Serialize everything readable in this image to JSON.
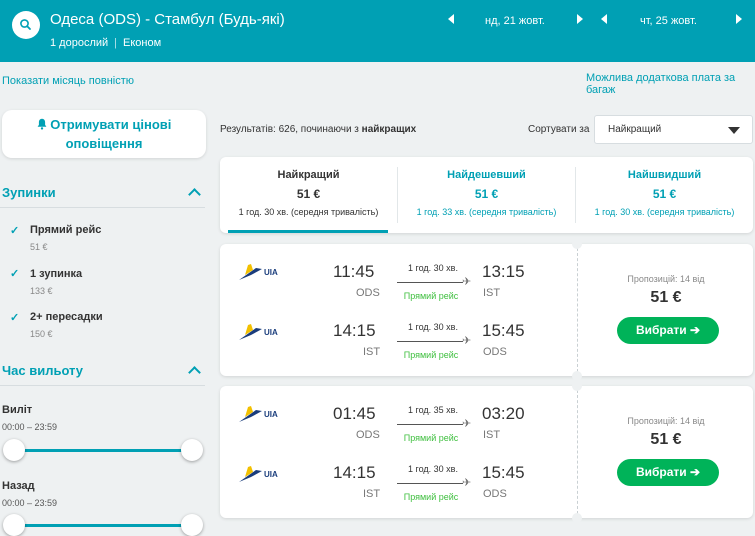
{
  "search": {
    "route": "Одеса (ODS) - Стамбул (Будь-які)",
    "passengers": "1 дорослий",
    "cabin": "Економ",
    "depart_date": "нд, 21 жовт.",
    "return_date": "чт, 25 жовт."
  },
  "links": {
    "show_month": "Показати місяць повністю",
    "baggage_fee": "Можлива додаткова плата за багаж"
  },
  "sidebar": {
    "alert_button_line1": "Отримувати цінові",
    "alert_button_line2": "оповіщення",
    "stops_title": "Зупинки",
    "stops": [
      {
        "label": "Прямий рейс",
        "price": "51 €"
      },
      {
        "label": "1 зупинка",
        "price": "133 €"
      },
      {
        "label": "2+ пересадки",
        "price": "150 €"
      }
    ],
    "depart_time_title": "Час вильоту",
    "outbound_label": "Виліт",
    "outbound_range": "00:00 – 23:59",
    "return_label": "Назад",
    "return_range": "00:00 – 23:59"
  },
  "results": {
    "prefix": "Результатів: 626, починаючи з ",
    "sort_word": "найкращих",
    "sort_label": "Сортувати за",
    "sort_value": "Найкращий"
  },
  "tabs": [
    {
      "title": "Найкращий",
      "price": "51 €",
      "duration": "1 год. 30 хв. (середня тривалість)"
    },
    {
      "title": "Найдешевший",
      "price": "51 €",
      "duration": "1 год. 33 хв. (середня тривалість)"
    },
    {
      "title": "Найшвидший",
      "price": "51 €",
      "duration": "1 год. 30 хв. (середня тривалість)"
    }
  ],
  "colors": {
    "accent": "#00a0b4",
    "button": "#00b359",
    "direct": "#3fbf3f"
  },
  "flights": [
    {
      "legs": [
        {
          "airline": "UIA",
          "dep_time": "11:45",
          "dep_code": "ODS",
          "duration": "1 год. 30 хв.",
          "stops": "Прямий рейс",
          "arr_time": "13:15",
          "arr_code": "IST"
        },
        {
          "airline": "UIA",
          "dep_time": "14:15",
          "dep_code": "IST",
          "duration": "1 год. 30 хв.",
          "stops": "Прямий рейс",
          "arr_time": "15:45",
          "arr_code": "ODS"
        }
      ],
      "offers": "Пропозицій: 14 від",
      "price": "51 €",
      "button": "Вибрати ➔"
    },
    {
      "legs": [
        {
          "airline": "UIA",
          "dep_time": "01:45",
          "dep_code": "ODS",
          "duration": "1 год. 35 хв.",
          "stops": "Прямий рейс",
          "arr_time": "03:20",
          "arr_code": "IST"
        },
        {
          "airline": "UIA",
          "dep_time": "14:15",
          "dep_code": "IST",
          "duration": "1 год. 30 хв.",
          "stops": "Прямий рейс",
          "arr_time": "15:45",
          "arr_code": "ODS"
        }
      ],
      "offers": "Пропозицій: 14 від",
      "price": "51 €",
      "button": "Вибрати ➔"
    }
  ]
}
